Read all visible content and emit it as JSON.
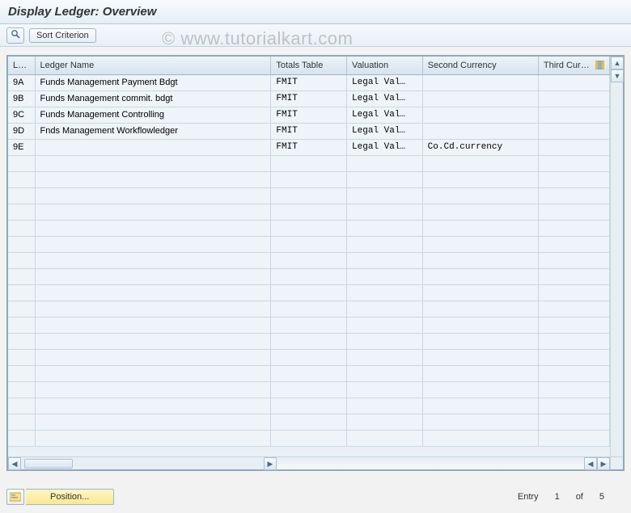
{
  "title": "Display Ledger: Overview",
  "watermark": "© www.tutorialkart.com",
  "toolbar": {
    "sort_criterion_label": "Sort Criterion"
  },
  "grid": {
    "columns": {
      "ledger": "L…",
      "name": "Ledger Name",
      "totals": "Totals Table",
      "valuation": "Valuation",
      "second_currency": "Second Currency",
      "third_currency": "Third Cur…"
    },
    "rows": [
      {
        "ledger": "9A",
        "name": "Funds Management Payment Bdgt",
        "totals": "FMIT",
        "valuation": "Legal Val…",
        "second": "",
        "third": ""
      },
      {
        "ledger": "9B",
        "name": "Funds Management commit. bdgt",
        "totals": "FMIT",
        "valuation": "Legal Val…",
        "second": "",
        "third": ""
      },
      {
        "ledger": "9C",
        "name": "Funds Management Controlling",
        "totals": "FMIT",
        "valuation": "Legal Val…",
        "second": "",
        "third": ""
      },
      {
        "ledger": "9D",
        "name": "Fnds Management Workflowledger",
        "totals": "FMIT",
        "valuation": "Legal Val…",
        "second": "",
        "third": ""
      },
      {
        "ledger": "9E",
        "name": "",
        "totals": "FMIT",
        "valuation": "Legal Val…",
        "second": "Co.Cd.currency",
        "third": ""
      }
    ],
    "empty_row_count": 18
  },
  "footer": {
    "position_label": "Position...",
    "entry_label": "Entry",
    "current": "1",
    "of_label": "of",
    "total": "5"
  }
}
